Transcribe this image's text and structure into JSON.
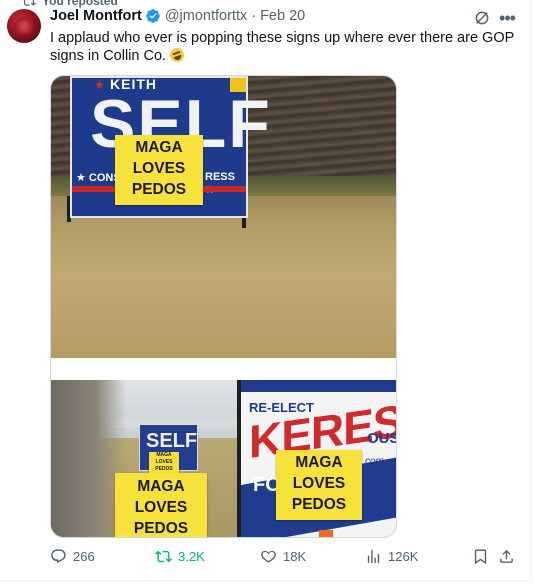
{
  "reposted": {
    "label": "You reposted"
  },
  "author": {
    "name": "Joel Montfort",
    "handle": "@jmontforttx",
    "separator": "·",
    "date": "Feb 20"
  },
  "tweet": {
    "text": "I applaud who ever is popping these signs up where ever there are GOP signs in Collin Co."
  },
  "media": {
    "photo1": {
      "sign_top": "KEITH",
      "sign_name": "SELF",
      "sign_band_left": "CONS",
      "sign_band_right": "RESS",
      "overlay_lines": [
        "MAGA",
        "LOVES",
        "PEDOS"
      ]
    },
    "photo2": {
      "small_sign_name": "SELF",
      "small_overlay_lines": [
        "MAGA",
        "LOVES",
        "PEDOS"
      ],
      "left_overlay_lines": [
        "MAGA",
        "LOVES",
        "PEDOS"
      ],
      "keresa_reelect": "RE-ELECT",
      "keresa_name": "KERESA",
      "keresa_ous": "OUS",
      "keresa_fo": "FO",
      "keresa_com": "com",
      "right_overlay_lines": [
        "MAGA",
        "LOVES",
        "PEDOS"
      ]
    }
  },
  "actions": {
    "replies": "266",
    "reposts": "3.2K",
    "likes": "18K",
    "views": "126K"
  },
  "colors": {
    "text": "#0f1419",
    "secondary": "#536471",
    "verified": "#1d9bf0",
    "repost_active": "#00ba7c",
    "sign_yellow": "#f6e23a"
  },
  "icons": [
    "repost-icon",
    "verified-badge-icon",
    "grok-icon",
    "more-icon",
    "reply-icon",
    "retweet-icon",
    "like-icon",
    "views-icon",
    "bookmark-icon",
    "share-icon"
  ]
}
